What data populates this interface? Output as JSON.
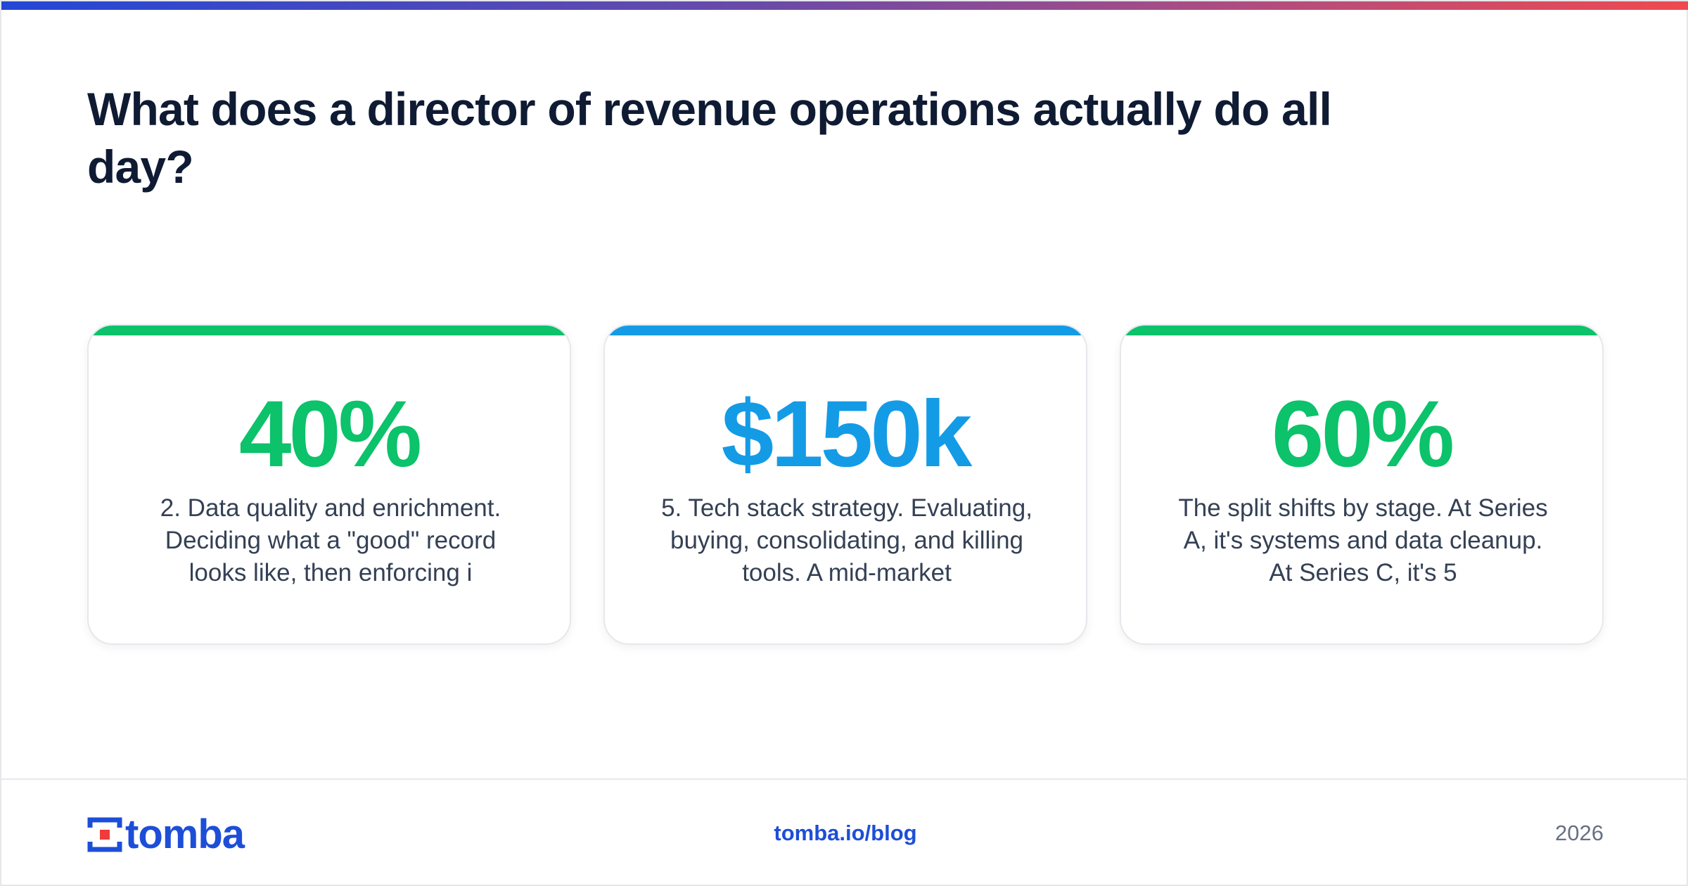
{
  "header": {
    "title": "What does a director of revenue operations actually do all day?"
  },
  "cards": [
    {
      "value": "40%",
      "text": "2. Data quality and enrichment. Deciding what a \"good\" record looks like, then enforcing i",
      "accent_color": "#0cc26a"
    },
    {
      "value": "$150k",
      "text": "5. Tech stack strategy. Evaluating, buying, consolidating, and killing tools. A mid-market",
      "accent_color": "#149be6"
    },
    {
      "value": "60%",
      "text": "The split shifts by stage. At Series A, it's systems and data cleanup. At Series C, it's 5",
      "accent_color": "#0cc26a"
    }
  ],
  "footer": {
    "logo_text": "tomba",
    "logo_icon": "tomba-logo-icon",
    "link": "tomba.io/blog",
    "year": "2026"
  },
  "colors": {
    "brand_blue": "#1d4ed8",
    "logo_red": "#ef3b3b",
    "green": "#0cc26a",
    "blue": "#149be6",
    "title": "#0f1b33",
    "body_text": "#344054",
    "muted": "#667085"
  }
}
